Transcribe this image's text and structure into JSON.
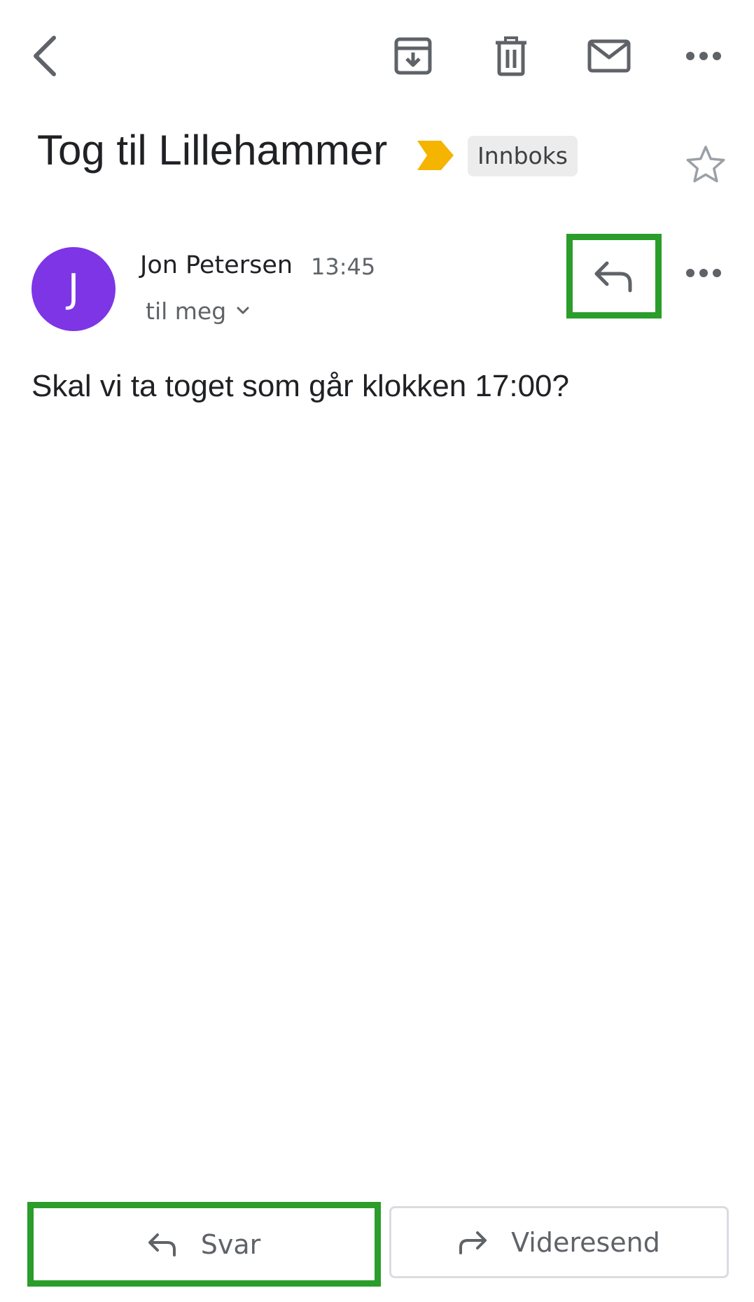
{
  "toolbar": {
    "back_icon": "back-arrow-icon",
    "archive_icon": "archive-icon",
    "delete_icon": "trash-icon",
    "mark_unread_icon": "mail-icon",
    "more_icon": "more-horizontal-icon"
  },
  "message": {
    "subject": "Tog til Lillehammer",
    "importance_color": "#f4b400",
    "label": "Innboks",
    "star_icon": "star-outline-icon",
    "sender": {
      "initial": "J",
      "avatar_color": "#7e35e6",
      "name": "Jon Petersen",
      "time": "13:45",
      "recipient": "til meg"
    },
    "body": "Skal vi ta toget som går klokken 17:00?"
  },
  "actions": {
    "reply_label": "Svar",
    "forward_label": "Videresend",
    "highlight_color": "#2a9d2a"
  }
}
